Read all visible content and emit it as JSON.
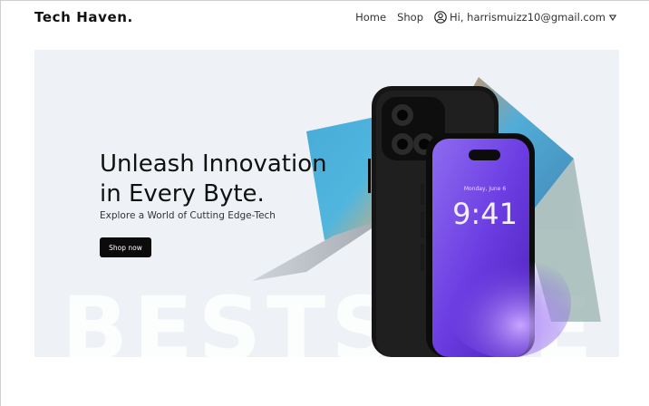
{
  "header": {
    "logo": "Tech Haven.",
    "nav": [
      "Home",
      "Shop"
    ],
    "user_label": "Hi, harrismuizz10@gmail.com"
  },
  "hero": {
    "title_line1": "Unleash Innovation",
    "title_line2": "in Every Byte.",
    "subtitle": "Explore a World of Cutting Edge-Tech",
    "cta": "Shop now",
    "watermark": "BESTSALE",
    "phone_date": "Monday, June 6",
    "phone_time": "9:41"
  },
  "colors": {
    "hero_bg": "#eef2f6",
    "button_bg": "#0b0b0b",
    "phone_purple": "#7b3fe4"
  }
}
